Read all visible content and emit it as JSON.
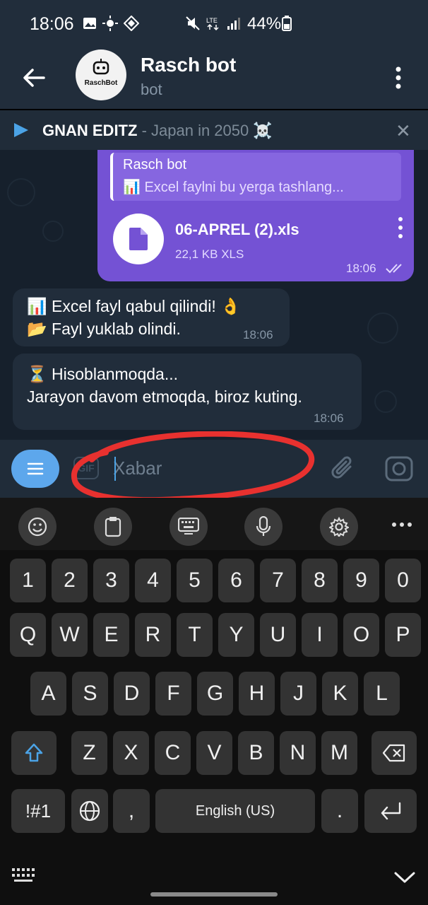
{
  "status_bar": {
    "time": "18:06",
    "battery": "44%"
  },
  "header": {
    "title": "Rasch bot",
    "subtitle": "bot",
    "avatar_label": "RaschBot"
  },
  "music_bar": {
    "artist": "GNAN EDITZ",
    "separator": " - ",
    "song": "Japan in 2050 ☠️"
  },
  "messages": {
    "outgoing": {
      "quote_name": "Rasch bot",
      "quote_text": "📊 Excel faylni bu yerga tashlang...",
      "file_name": "06-APREL (2).xls",
      "file_size": "22,1 KB XLS",
      "time": "18:06"
    },
    "in1": {
      "line1": "📊 Excel fayl qabul qilindi! 👌",
      "line2": "📂 Fayl yuklab olindi.",
      "time": "18:06"
    },
    "in2": {
      "line1": "⏳ Hisoblanmoqda...",
      "line2": "Jarayon davom etmoqda, biroz kuting.",
      "time": "18:06"
    }
  },
  "input": {
    "placeholder": "Xabar",
    "gif_label": "GIF"
  },
  "keyboard": {
    "numbers": [
      "1",
      "2",
      "3",
      "4",
      "5",
      "6",
      "7",
      "8",
      "9",
      "0"
    ],
    "row1": [
      "Q",
      "W",
      "E",
      "R",
      "T",
      "Y",
      "U",
      "I",
      "O",
      "P"
    ],
    "row2": [
      "A",
      "S",
      "D",
      "F",
      "G",
      "H",
      "J",
      "K",
      "L"
    ],
    "row3": [
      "Z",
      "X",
      "C",
      "V",
      "B",
      "N",
      "M"
    ],
    "symbols_label": "!#1",
    "comma": ",",
    "space_label": "English (US)",
    "period": "."
  },
  "colors": {
    "accent": "#4ba3e6",
    "outgoing_bubble": "#7452d4",
    "annotation": "#e8312f"
  }
}
